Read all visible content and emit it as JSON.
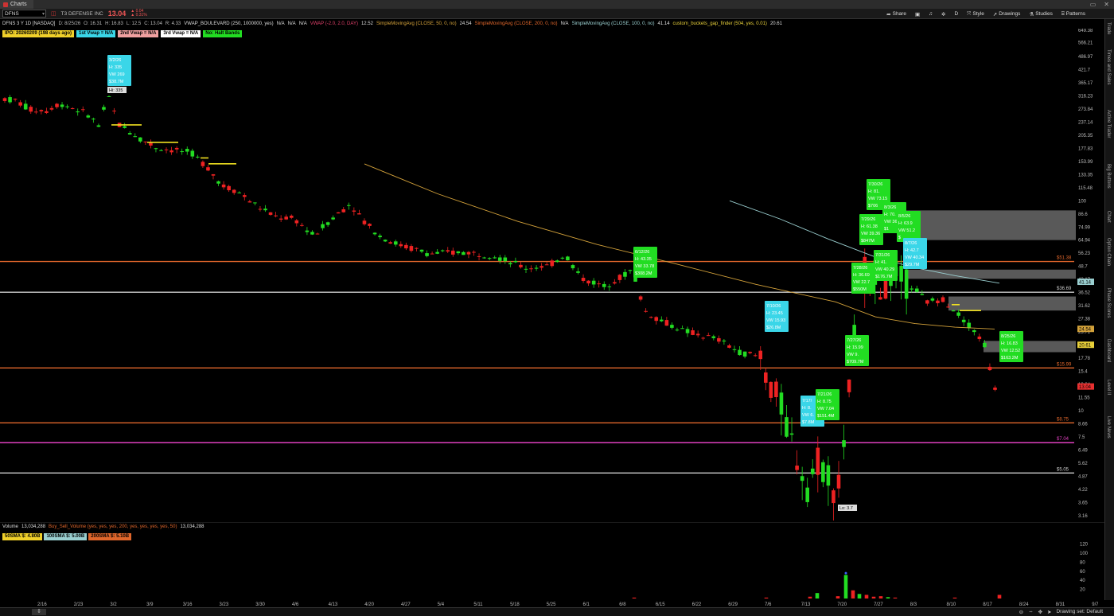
{
  "window": {
    "tab_title": "Charts"
  },
  "toolbar": {
    "symbol": "DFNS",
    "company": "T3 DEFENSE INC",
    "last": "13.04",
    "change": "▲ 0.04",
    "change_pct": "▲ 0.31%",
    "share_label": "Share",
    "interval_label": "D",
    "style_label": "Style",
    "drawings_label": "Drawings",
    "studies_label": "Studies",
    "patterns_label": "Patterns"
  },
  "infobar": [
    {
      "text": "DFNS 3 Y 1D [NASDAQ]",
      "color": "#dddddd"
    },
    {
      "text": "D: 8/25/26",
      "color": "#bbbbbb"
    },
    {
      "text": "O: 16.31",
      "color": "#bbbbbb"
    },
    {
      "text": "H: 16.83",
      "color": "#bbbbbb"
    },
    {
      "text": "L: 12.5",
      "color": "#bbbbbb"
    },
    {
      "text": "C: 13.04",
      "color": "#bbbbbb"
    },
    {
      "text": "R: 4.33",
      "color": "#bbbbbb"
    },
    {
      "text": "VWAP_BOULEVARD (250, 1000000, yes)",
      "color": "#dddddd"
    },
    {
      "text": "N/A",
      "color": "#dddddd"
    },
    {
      "text": "N/A",
      "color": "#dddddd"
    },
    {
      "text": "N/A",
      "color": "#dddddd"
    },
    {
      "text": "VWAP (-2.0, 2.0, DAY)",
      "color": "#e0406a"
    },
    {
      "text": "12.52",
      "color": "#dddddd"
    },
    {
      "text": "SimpleMovingAvg (CLOSE, 50, 0, no)",
      "color": "#d4a23a"
    },
    {
      "text": "24.54",
      "color": "#dddddd"
    },
    {
      "text": "SimpleMovingAvg (CLOSE, 200, 0, no)",
      "color": "#e0662b"
    },
    {
      "text": "N/A",
      "color": "#dddddd"
    },
    {
      "text": "SimpleMovingAvg (CLOSE, 100, 0, no)",
      "color": "#9acfd0"
    },
    {
      "text": "41.14",
      "color": "#dddddd"
    },
    {
      "text": "custom_buckets_gap_finder (504, yes, 0.01)",
      "color": "#e8d03a"
    },
    {
      "text": "20.61",
      "color": "#dddddd"
    }
  ],
  "badges": [
    {
      "text": "IPO: 20260209 (198 days ago)",
      "bg": "#f0d02a"
    },
    {
      "text": "1st Vwap = N/A",
      "bg": "#3ad6e8"
    },
    {
      "text": "2nd Vwap = N/A",
      "bg": "#f0a0a0"
    },
    {
      "text": "3rd Vwap = N/A",
      "bg": "#ffffff"
    },
    {
      "text": "No: Halt Bands",
      "bg": "#22dd22"
    }
  ],
  "chart_data": {
    "type": "candlestick",
    "y_scale": "log",
    "price_ticks": [
      "649.38",
      "566.21",
      "486.97",
      "421.7",
      "365.17",
      "316.23",
      "273.84",
      "237.14",
      "205.35",
      "177.83",
      "153.99",
      "133.35",
      "115.48",
      "100",
      "86.6",
      "74.99",
      "64.94",
      "56.23",
      "48.7",
      "42.17",
      "36.52",
      "31.62",
      "27.38",
      "23.71",
      "20.54",
      "17.78",
      "15.4",
      "13.34",
      "11.55",
      "10",
      "8.66",
      "7.5",
      "6.49",
      "5.62",
      "4.87",
      "4.22",
      "3.65",
      "3.16"
    ],
    "date_labels": [
      "2/16",
      "2/23",
      "3/2",
      "3/9",
      "3/16",
      "3/23",
      "3/30",
      "4/6",
      "4/13",
      "4/20",
      "4/27",
      "5/4",
      "5/11",
      "5/18",
      "5/25",
      "6/1",
      "6/8",
      "6/15",
      "6/22",
      "6/29",
      "7/6",
      "7/13",
      "7/20",
      "7/27",
      "8/3",
      "8/10",
      "8/17",
      "8/24",
      "8/31",
      "9/7"
    ],
    "price_markers": [
      {
        "label": "51.38",
        "value": 51.38,
        "color": "#e0662b"
      },
      {
        "label": "36.69",
        "value": 36.69,
        "color": "#cccccc"
      },
      {
        "label": "41.14",
        "value": 41.14,
        "color": "#9acfd0",
        "box": true
      },
      {
        "label": "24.54",
        "value": 24.54,
        "color": "#d4a23a",
        "box": true
      },
      {
        "label": "20.61",
        "value": 20.61,
        "color": "#e8d03a",
        "box": true
      },
      {
        "label": "15.99",
        "value": 15.99,
        "color": "#e0662b"
      },
      {
        "label": "13.04",
        "value": 13.04,
        "color": "#e83030",
        "box": true
      },
      {
        "label": "8.75",
        "value": 8.75,
        "color": "#e0662b"
      },
      {
        "label": "7.04",
        "value": 7.04,
        "color": "#e040c0"
      },
      {
        "label": "5.05",
        "value": 5.05,
        "color": "#cccccc"
      }
    ],
    "annotations": [
      {
        "lines": [
          "3/2/26",
          "H: 335",
          "VW 269",
          "$38.7M"
        ],
        "color": "#3ad6e8"
      },
      {
        "lines": [
          "6/12/26",
          "H: 43.35",
          "VW 33.78",
          "$308.2M"
        ],
        "color": "#22dd22"
      },
      {
        "lines": [
          "7/10/26",
          "H: 23.45",
          "VW 15.93",
          "$26.8M"
        ],
        "color": "#3ad6e8"
      },
      {
        "lines": [
          "7/17/",
          "H: 8.",
          "VW 6.",
          "$7.8M"
        ],
        "color": "#3ad6e8"
      },
      {
        "lines": [
          "7/21/26",
          "H: 8.75",
          "VW 7.04",
          "$151.4M"
        ],
        "color": "#22dd22"
      },
      {
        "lines": [
          "7/27/26",
          "H: 15.99",
          "VW 9.",
          "$709.7M"
        ],
        "color": "#22dd22"
      },
      {
        "lines": [
          "7/28/26",
          "H: 36.69",
          "VW 22.7",
          "$550M"
        ],
        "color": "#22dd22"
      },
      {
        "lines": [
          "7/29/26",
          "H: 61.38",
          "VW 39.36",
          "$847M"
        ],
        "color": "#22dd22"
      },
      {
        "lines": [
          "7/30/26",
          "H: 81.",
          "VW 73.15",
          "$706"
        ],
        "color": "#22dd22"
      },
      {
        "lines": [
          "7/31/26",
          "H: 41.",
          "VW 40.29",
          "$176.7M"
        ],
        "color": "#22dd22"
      },
      {
        "lines": [
          "8/3/26",
          "H: 70.",
          "VW 36.",
          "$1"
        ],
        "color": "#22dd22"
      },
      {
        "lines": [
          "8/5/26",
          "H: 63.9",
          "VW 51.2",
          "$"
        ],
        "color": "#22dd22"
      },
      {
        "lines": [
          "8/7/26",
          "H: 42.7",
          "VW 40.34",
          "$29.7M"
        ],
        "color": "#3ad6e8"
      },
      {
        "lines": [
          "8/25/26",
          "H: 16.83",
          "VW 12.52",
          "$163.2M"
        ],
        "color": "#22dd22"
      }
    ],
    "hi_label": "Hi: 335",
    "lo_label": "Lo: 3.7",
    "colors": {
      "up": "#22dd22",
      "down": "#ee2222",
      "sma50": "#d4a23a",
      "sma100": "#9acfd0",
      "sma200": "#e0662b"
    }
  },
  "volume": {
    "label": "Volume",
    "value": "13,034,288",
    "study": "Buy_Sell_Volume (yes, yes, yes, 200, yes, yes, yes, yes, 50)",
    "study_value": "13,034,288",
    "ticks": [
      "120",
      "100",
      "80",
      "60",
      "40",
      "20"
    ],
    "sma_badges": [
      {
        "text": "50SMA $: 4.80B",
        "bg": "#f0d02a"
      },
      {
        "text": "100SMA $: 5.00B",
        "bg": "#9acfd0"
      },
      {
        "text": "200SMA $: 5.10B",
        "bg": "#e0662b"
      }
    ]
  },
  "status": {
    "handle": "⇕",
    "drawing_set": "Drawing set: Default"
  },
  "sidebar": [
    "Trade",
    "Times and Sales",
    "Active Trader",
    "Big Buttons",
    "Chart",
    "Option Chain",
    "Phase Scores",
    "Dashboard",
    "Level II",
    "Live News"
  ]
}
